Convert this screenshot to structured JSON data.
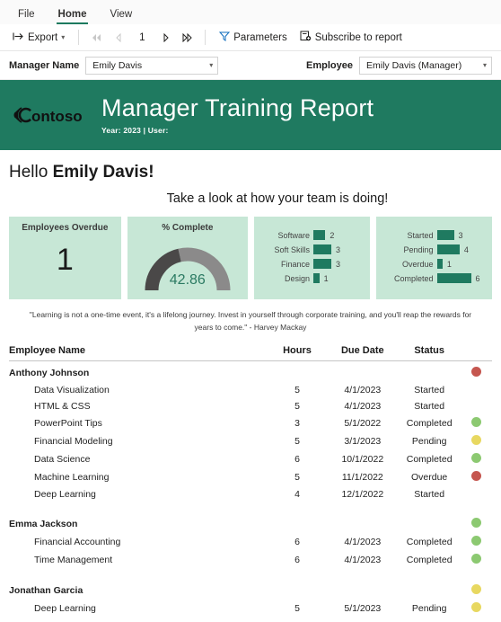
{
  "ribbon": {
    "tabs": [
      {
        "label": "File",
        "active": false
      },
      {
        "label": "Home",
        "active": true
      },
      {
        "label": "View",
        "active": false
      }
    ]
  },
  "toolbar": {
    "export_label": "Export",
    "export_icon": "export-icon",
    "caret_icon": "chevron-down-icon",
    "nav": {
      "first_icon": "first-page-icon",
      "prev_icon": "previous-page-icon",
      "page": "1",
      "next_icon": "next-page-icon",
      "last_icon": "last-page-icon"
    },
    "parameters_label": "Parameters",
    "parameters_icon": "filter-funnel-icon",
    "subscribe_label": "Subscribe to report",
    "subscribe_icon": "subscribe-document-icon"
  },
  "parameters": {
    "manager": {
      "label": "Manager Name",
      "value": "Emily Davis"
    },
    "employee": {
      "label": "Employee",
      "value": "Emily Davis (Manager)"
    }
  },
  "banner": {
    "logo_text": "ontoso",
    "logo_name": "contoso-logo",
    "title": "Manager Training Report",
    "subtitle": "Year: 2023 | User:",
    "bg_color": "#1f7a60"
  },
  "greeting": {
    "hello": "Hello ",
    "name": "Emily Davis!",
    "subhead": "Take a look at how your team is doing!"
  },
  "cards": {
    "overdue": {
      "title": "Employees Overdue",
      "value": "1"
    },
    "complete": {
      "title": "% Complete",
      "value": "42.86",
      "percent": 42.86,
      "arc_filled_color": "#4a4848",
      "arc_empty_color": "#8b8a8a"
    },
    "category": {
      "bar_color": "#1f7a60",
      "items": [
        {
          "label": "Software",
          "value": "2",
          "n": 2
        },
        {
          "label": "Soft Skills",
          "value": "3",
          "n": 3
        },
        {
          "label": "Finance",
          "value": "3",
          "n": 3
        },
        {
          "label": "Design",
          "value": "1",
          "n": 1
        }
      ]
    },
    "status": {
      "bar_color": "#1f7a60",
      "items": [
        {
          "label": "Started",
          "value": "3",
          "n": 3
        },
        {
          "label": "Pending",
          "value": "4",
          "n": 4
        },
        {
          "label": "Overdue",
          "value": "1",
          "n": 1
        },
        {
          "label": "Completed",
          "value": "6",
          "n": 6
        }
      ]
    },
    "bg_color": "#c7e7d6"
  },
  "quote": "\"Learning is not a one-time event, it's a lifelong journey. Invest in yourself through corporate training, and you'll reap the rewards for years to come.\" - Harvey Mackay",
  "table": {
    "columns": {
      "name": "Employee Name",
      "hours": "Hours",
      "due": "Due Date",
      "status": "Status"
    },
    "status_colors": {
      "Completed": "#8cc971",
      "Pending": "#e8d860",
      "Overdue": "#c5564f",
      "Started": ""
    },
    "groups": [
      {
        "name": "Anthony Johnson",
        "dot": "#c5564f",
        "rows": [
          {
            "name": "Data Visualization",
            "hours": "5",
            "due": "4/1/2023",
            "status": "Started",
            "dot": ""
          },
          {
            "name": "HTML & CSS",
            "hours": "5",
            "due": "4/1/2023",
            "status": "Started",
            "dot": ""
          },
          {
            "name": "PowerPoint Tips",
            "hours": "3",
            "due": "5/1/2022",
            "status": "Completed",
            "dot": "#8cc971"
          },
          {
            "name": "Financial Modeling",
            "hours": "5",
            "due": "3/1/2023",
            "status": "Pending",
            "dot": "#e8d860"
          },
          {
            "name": "Data Science",
            "hours": "6",
            "due": "10/1/2022",
            "status": "Completed",
            "dot": "#8cc971"
          },
          {
            "name": "Machine Learning",
            "hours": "5",
            "due": "11/1/2022",
            "status": "Overdue",
            "dot": "#c5564f"
          },
          {
            "name": "Deep Learning",
            "hours": "4",
            "due": "12/1/2022",
            "status": "Started",
            "dot": ""
          }
        ]
      },
      {
        "name": "Emma Jackson",
        "dot": "#8cc971",
        "rows": [
          {
            "name": "Financial Accounting",
            "hours": "6",
            "due": "4/1/2023",
            "status": "Completed",
            "dot": "#8cc971"
          },
          {
            "name": "Time Management",
            "hours": "6",
            "due": "4/1/2023",
            "status": "Completed",
            "dot": "#8cc971"
          }
        ]
      },
      {
        "name": "Jonathan Garcia",
        "dot": "#e8d860",
        "rows": [
          {
            "name": "Deep Learning",
            "hours": "5",
            "due": "5/1/2023",
            "status": "Pending",
            "dot": "#e8d860"
          }
        ]
      }
    ]
  }
}
